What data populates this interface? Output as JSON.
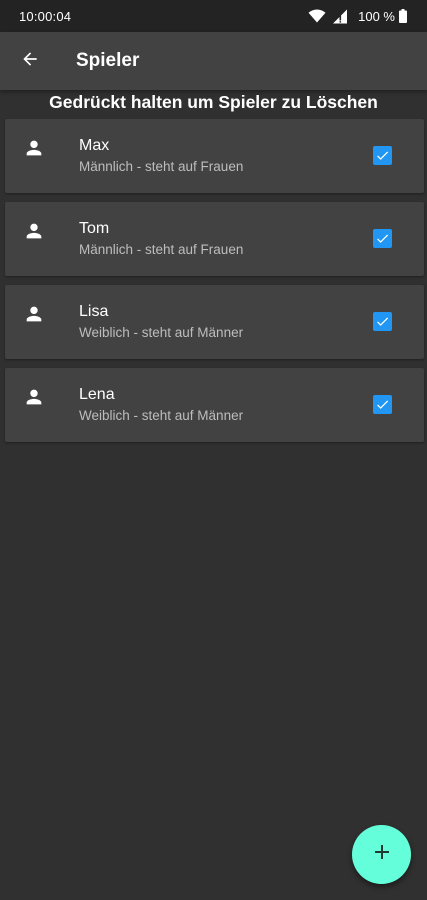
{
  "status_bar": {
    "time": "10:00:04",
    "battery_text": "100 %",
    "icons": [
      "wifi-icon",
      "signal-icon",
      "battery-icon"
    ]
  },
  "app_bar": {
    "title": "Spieler",
    "back_icon": "arrow-back-icon"
  },
  "hint": "Gedrückt halten um Spieler zu Löschen",
  "players": [
    {
      "name": "Max",
      "description": "Männlich - steht auf Frauen",
      "icon": "person-icon",
      "checked": true
    },
    {
      "name": "Tom",
      "description": "Männlich - steht auf Frauen",
      "icon": "person-icon",
      "checked": true
    },
    {
      "name": "Lisa",
      "description": "Weiblich - steht auf Männer",
      "icon": "person-icon",
      "checked": true
    },
    {
      "name": "Lena",
      "description": "Weiblich - steht auf Männer",
      "icon": "person-icon",
      "checked": true
    }
  ],
  "fab": {
    "icon": "plus-icon"
  },
  "colors": {
    "background": "#303030",
    "card": "#424242",
    "appbar": "#424242",
    "checkbox": "#2196f3",
    "fab": "#64ffda",
    "secondary_text": "#bdbdbd"
  }
}
